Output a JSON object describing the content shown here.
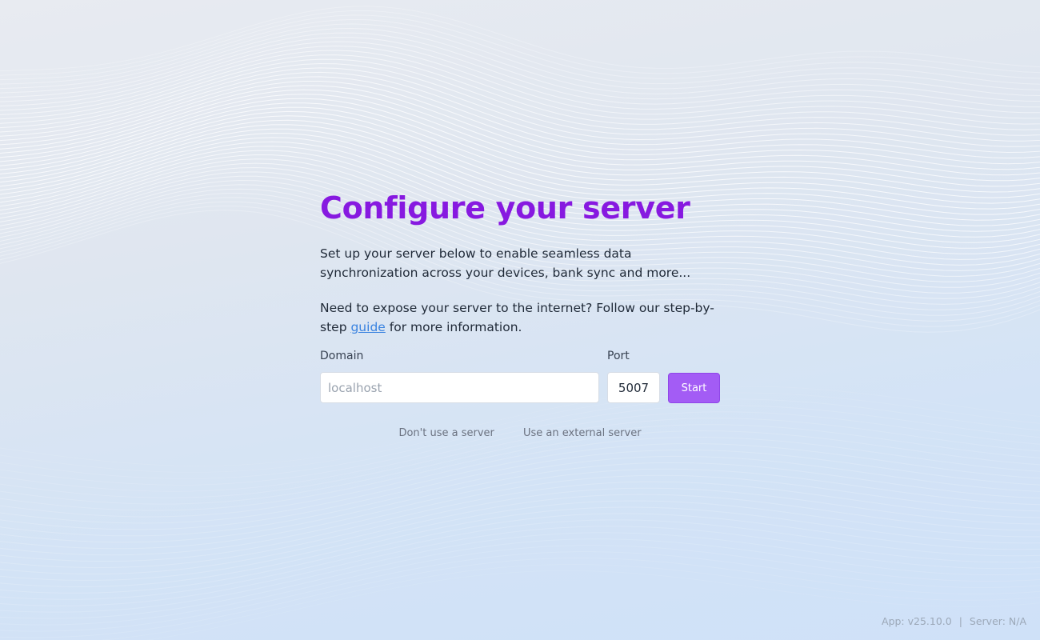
{
  "page": {
    "title": "Configure your server",
    "description": "Set up your server below to enable seamless data synchronization across your devices, bank sync and more...",
    "expose_text_before": "Need to expose your server to the internet? Follow our step-by-step ",
    "guide_link": "guide",
    "expose_text_after": " for more information."
  },
  "form": {
    "domain_label": "Domain",
    "domain_placeholder": "localhost",
    "domain_value": "",
    "port_label": "Port",
    "port_value": "5007",
    "start_label": "Start"
  },
  "links": {
    "no_server": "Don't use a server",
    "external_server": "Use an external server"
  },
  "footer": {
    "app_version": "App: v25.10.0",
    "separator": "|",
    "server_version": "Server: N/A"
  },
  "colors": {
    "title": "#8719e0",
    "start_button": "#a35cf5",
    "link": "#3a83e0"
  }
}
